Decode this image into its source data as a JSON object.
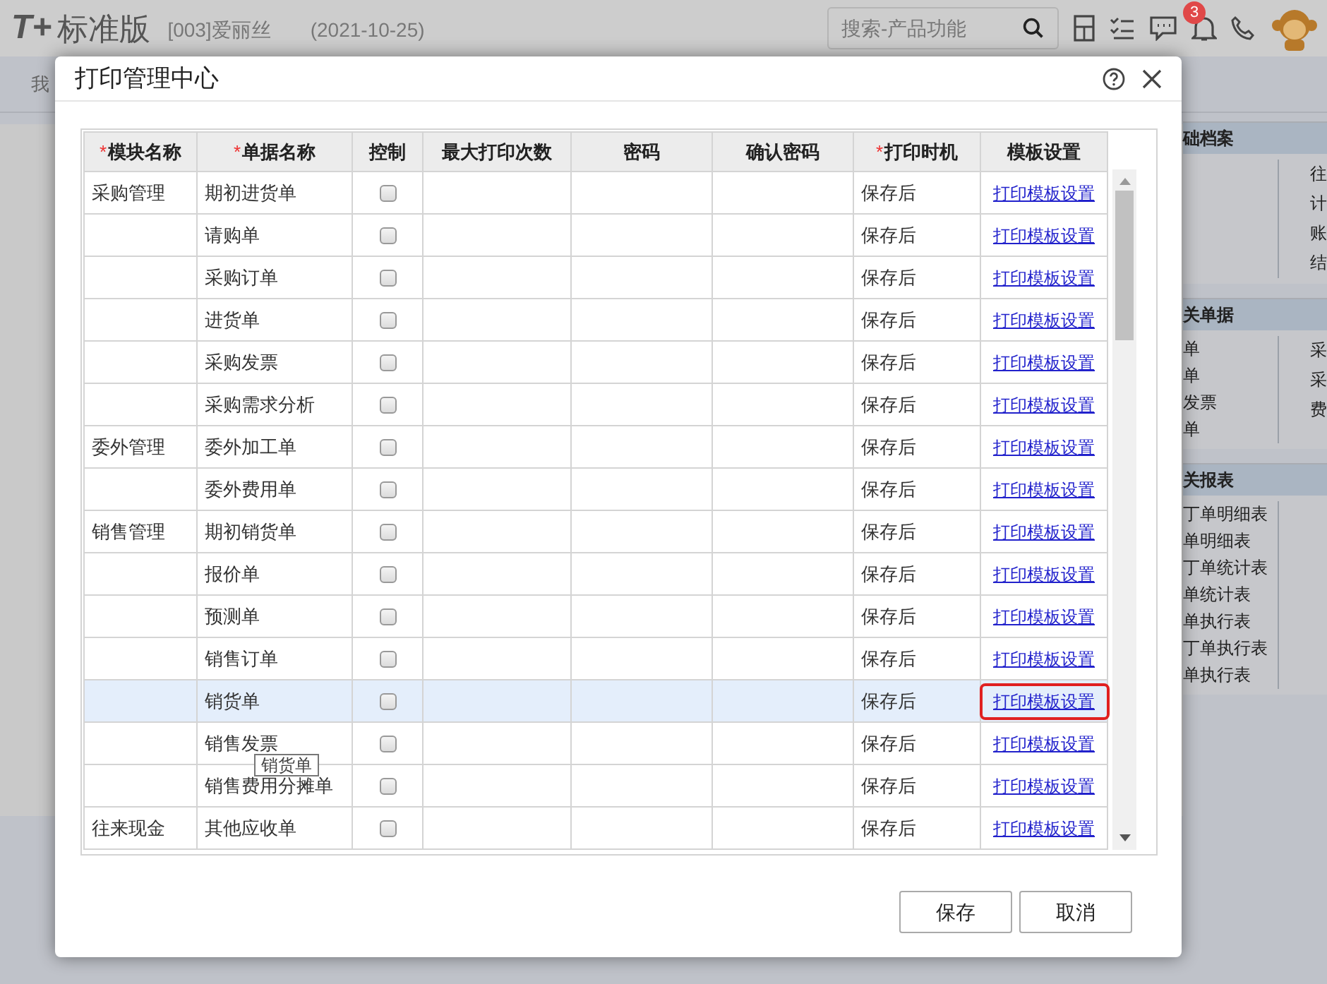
{
  "app_header": {
    "logo": "T+",
    "edition": "标准版",
    "account": "[003]爱丽丝",
    "date": "(2021-10-25)",
    "search": {
      "placeholder": "搜索-产品功能"
    },
    "notification_count": "3"
  },
  "nav_tab": "我",
  "side_panels": [
    {
      "title": "础档案",
      "right": [
        "往",
        "计",
        "账",
        "结"
      ]
    },
    {
      "title": "关单据",
      "left": [
        "单",
        "单",
        "发票",
        "单"
      ],
      "right": [
        "采",
        "采",
        "费"
      ]
    },
    {
      "title": "关报表",
      "left": [
        "丁单明细表",
        "单明细表",
        "丁单统计表",
        "单统计表",
        "单执行表",
        "丁单执行表",
        "单执行表"
      ]
    }
  ],
  "dialog": {
    "title": "打印管理中心",
    "columns": [
      {
        "label": "模块名称",
        "required_mark": "*"
      },
      {
        "label": "单据名称",
        "required_mark": "*"
      },
      {
        "label": "控制"
      },
      {
        "label": "最大打印次数"
      },
      {
        "label": "密码"
      },
      {
        "label": "确认密码"
      },
      {
        "label": "打印时机",
        "required_mark": "*"
      },
      {
        "label": "模板设置"
      }
    ],
    "rows": [
      {
        "module": "采购管理",
        "document": "期初进货单",
        "control": false,
        "timing": "保存后",
        "link": "打印模板设置",
        "selected": false,
        "focused": false
      },
      {
        "module": "",
        "document": "请购单",
        "control": false,
        "timing": "保存后",
        "link": "打印模板设置",
        "selected": false,
        "focused": false
      },
      {
        "module": "",
        "document": "采购订单",
        "control": false,
        "timing": "保存后",
        "link": "打印模板设置",
        "selected": false,
        "focused": false
      },
      {
        "module": "",
        "document": "进货单",
        "control": false,
        "timing": "保存后",
        "link": "打印模板设置",
        "selected": false,
        "focused": false
      },
      {
        "module": "",
        "document": "采购发票",
        "control": false,
        "timing": "保存后",
        "link": "打印模板设置",
        "selected": false,
        "focused": false
      },
      {
        "module": "",
        "document": "采购需求分析",
        "control": false,
        "timing": "保存后",
        "link": "打印模板设置",
        "selected": false,
        "focused": false
      },
      {
        "module": "委外管理",
        "document": "委外加工单",
        "control": false,
        "timing": "保存后",
        "link": "打印模板设置",
        "selected": false,
        "focused": false
      },
      {
        "module": "",
        "document": "委外费用单",
        "control": false,
        "timing": "保存后",
        "link": "打印模板设置",
        "selected": false,
        "focused": false
      },
      {
        "module": "销售管理",
        "document": "期初销货单",
        "control": false,
        "timing": "保存后",
        "link": "打印模板设置",
        "selected": false,
        "focused": false
      },
      {
        "module": "",
        "document": "报价单",
        "control": false,
        "timing": "保存后",
        "link": "打印模板设置",
        "selected": false,
        "focused": false
      },
      {
        "module": "",
        "document": "预测单",
        "control": false,
        "timing": "保存后",
        "link": "打印模板设置",
        "selected": false,
        "focused": false
      },
      {
        "module": "",
        "document": "销售订单",
        "control": false,
        "timing": "保存后",
        "link": "打印模板设置",
        "selected": false,
        "focused": false
      },
      {
        "module": "",
        "document": "销货单",
        "control": false,
        "timing": "保存后",
        "link": "打印模板设置",
        "selected": true,
        "focused": true
      },
      {
        "module": "",
        "document": "销售发票",
        "control": false,
        "timing": "保存后",
        "link": "打印模板设置",
        "selected": false,
        "focused": false
      },
      {
        "module": "",
        "document": "销售费用分摊单",
        "control": false,
        "timing": "保存后",
        "link": "打印模板设置",
        "selected": false,
        "focused": false
      },
      {
        "module": "往来现金",
        "document": "其他应收单",
        "control": false,
        "timing": "保存后",
        "link": "打印模板设置",
        "selected": false,
        "focused": false
      }
    ],
    "tooltip": "销货单",
    "buttons": [
      "保存",
      "取消"
    ]
  }
}
